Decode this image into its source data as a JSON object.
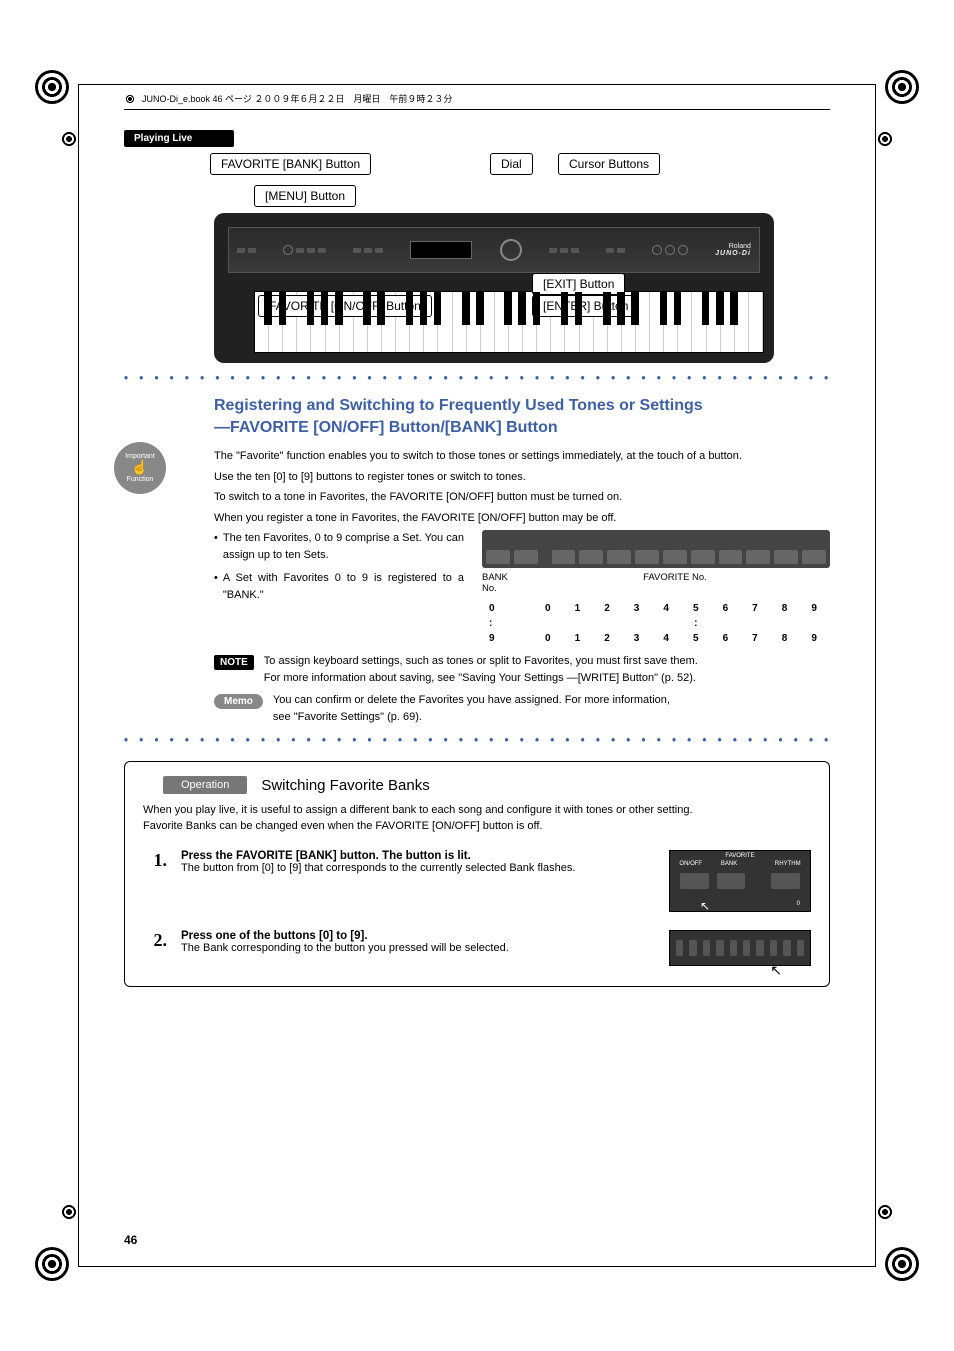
{
  "book_header": "JUNO-Di_e.book  46 ページ  ２００９年６月２２日　月曜日　午前９時２３分",
  "running_head": "Playing Live",
  "page_number": "46",
  "figure": {
    "callouts": {
      "fav_bank": "FAVORITE [BANK] Button",
      "menu": "[MENU] Button",
      "dial": "Dial",
      "cursor": "Cursor Buttons",
      "fav_onoff_bottom": "FAVORITE [ON/OFF] Button",
      "exit": "[EXIT] Button",
      "enter": "[ENTER] Button",
      "brand1": "Roland",
      "brand2": "JUNO-Di"
    }
  },
  "section_title_line1": "Registering and Switching to Frequently Used Tones or Settings",
  "section_title_line2": "—FAVORITE [ON/OFF] Button/[BANK] Button",
  "paragraphs": {
    "p1": "The \"Favorite\" function enables you to switch to those tones or settings immediately, at the touch of a button.",
    "p2": "Use the ten [0] to [9] buttons to register tones or switch to tones.",
    "p3": "To switch to a tone in Favorites, the FAVORITE [ON/OFF] button must be turned on.",
    "p4": "When you register a tone in Favorites, the FAVORITE [ON/OFF] button may be off."
  },
  "bullets": {
    "b1": "The ten Favorites, 0 to 9 comprise a Set. You can assign up to ten Sets.",
    "b2": "A Set with Favorites 0 to 9 is registered to a \"BANK.\""
  },
  "bank_diagram": {
    "bank_no_label": "BANK No.",
    "fav_no_label": "FAVORITE No.",
    "rows": [
      {
        "bank": "0",
        "nums": [
          "0",
          "1",
          "2",
          "3",
          "4",
          "5",
          "6",
          "7",
          "8",
          "9"
        ]
      },
      {
        "bank": ":",
        "nums": [
          "",
          "",
          "",
          "",
          "",
          ":",
          "",
          "",
          "",
          ""
        ]
      },
      {
        "bank": "9",
        "nums": [
          "0",
          "1",
          "2",
          "3",
          "4",
          "5",
          "6",
          "7",
          "8",
          "9"
        ]
      }
    ]
  },
  "note": {
    "label": "NOTE",
    "line1": "To assign keyboard settings, such as tones or split to Favorites, you must first save them.",
    "line2": "For more information about saving, see  \"Saving Your Settings —[WRITE] Button\" (p. 52)."
  },
  "memo": {
    "label": "Memo",
    "line1": "You can confirm or delete the Favorites you have assigned. For more information,",
    "line2": "see  \"Favorite Settings\" (p. 69)."
  },
  "operation": {
    "tag": "Operation",
    "title": "Switching Favorite Banks",
    "intro1": "When you play live, it is useful to assign a different bank to each song and configure it with tones or other setting.",
    "intro2": "Favorite Banks can be changed even when the FAVORITE [ON/OFF] button is off.",
    "steps": [
      {
        "num": "1.",
        "bold": "Press the FAVORITE [BANK] button. The button is lit.",
        "text": "The button from [0] to [9] that corresponds to the currently selected Bank flashes.",
        "fig_labels": [
          "FAVORITE",
          "ON/OFF",
          "BANK",
          "RHYTHM",
          "0"
        ]
      },
      {
        "num": "2.",
        "bold": "Press one of the buttons [0] to [9].",
        "text": "The Bank corresponding to the button you pressed will be selected."
      }
    ]
  },
  "side_badge": {
    "top": "Important",
    "bottom": "Function"
  }
}
